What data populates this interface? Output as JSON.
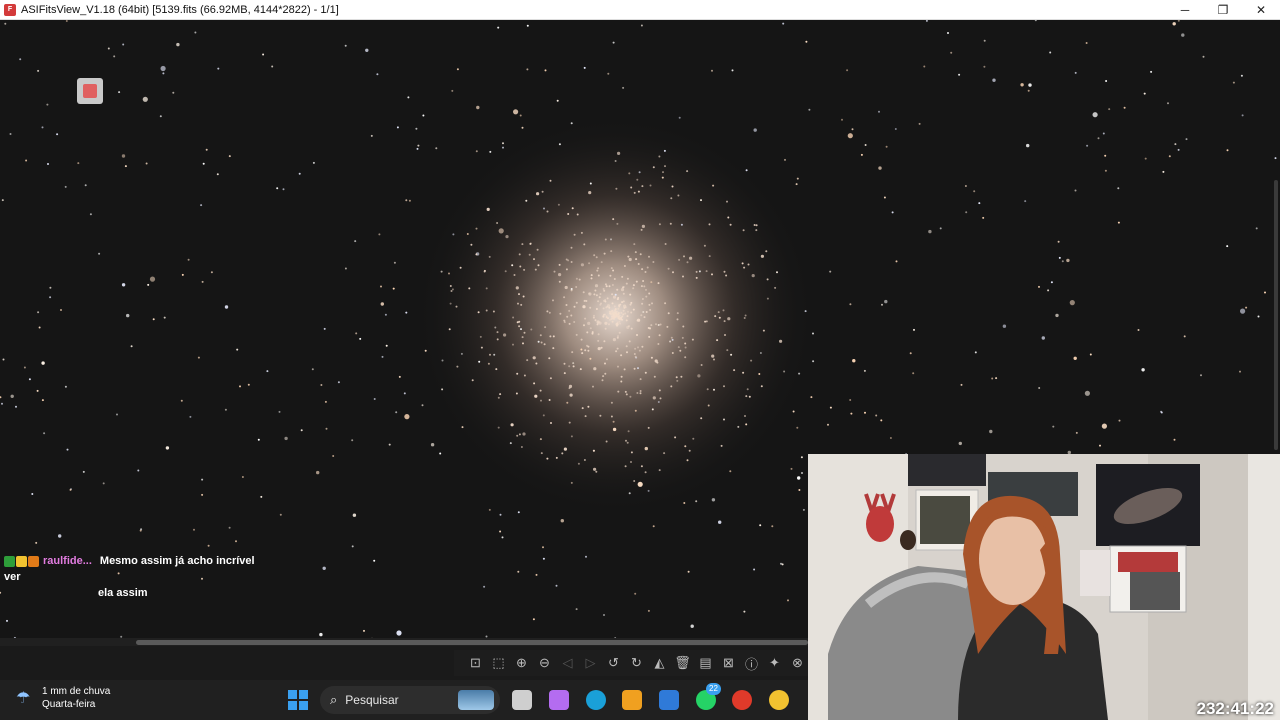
{
  "window": {
    "title": "ASIFitsView_V1.18 (64bit) [5139.fits (66.92MB, 4144*2822) - 1/1]",
    "app_icon": "asifitsview-icon",
    "controls": {
      "minimize": "─",
      "maximize": "❐",
      "close": "✕"
    }
  },
  "chat": {
    "username": "raulfide...",
    "message_line1": "Mesmo assim já acho incrível ver",
    "message_line2": "ela assim",
    "badge_colors": [
      "#2e9e3a",
      "#f2c230",
      "#e07a18"
    ]
  },
  "toolbar": {
    "tools": [
      {
        "name": "fit-icon",
        "glyph": "⊡",
        "enabled": true
      },
      {
        "name": "actual-size-icon",
        "glyph": "⬚",
        "enabled": true
      },
      {
        "name": "zoom-in-icon",
        "glyph": "⊕",
        "enabled": true
      },
      {
        "name": "zoom-out-icon",
        "glyph": "⊖",
        "enabled": true
      },
      {
        "name": "previous-icon",
        "glyph": "◁",
        "enabled": false
      },
      {
        "name": "next-icon",
        "glyph": "▷",
        "enabled": false
      },
      {
        "name": "rotate-left-icon",
        "glyph": "↺",
        "enabled": true
      },
      {
        "name": "rotate-right-icon",
        "glyph": "↻",
        "enabled": true
      },
      {
        "name": "histogram-icon",
        "glyph": "◭",
        "enabled": true
      },
      {
        "name": "delete-icon",
        "glyph": "🗑",
        "enabled": true
      },
      {
        "name": "save-icon",
        "glyph": "▤",
        "enabled": true
      },
      {
        "name": "crop-icon",
        "glyph": "⊠",
        "enabled": true
      },
      {
        "name": "info-icon",
        "glyph": "ⓘ",
        "enabled": true
      },
      {
        "name": "star-detect-icon",
        "glyph": "✦",
        "enabled": true
      },
      {
        "name": "crosshair-icon",
        "glyph": "⊗",
        "enabled": true
      }
    ]
  },
  "taskbar": {
    "weather_line1": "1 mm de chuva",
    "weather_line2": "Quarta-feira",
    "search_placeholder": "Pesquisar",
    "whatsapp_badge": "22",
    "apps": [
      {
        "name": "task-view-icon",
        "color": "#cfcfcf"
      },
      {
        "name": "copilot-icon",
        "color": "#b46cf0"
      },
      {
        "name": "edge-icon",
        "color": "#1aa0d8"
      },
      {
        "name": "store-icon",
        "color": "#f0a020"
      },
      {
        "name": "app-box-icon",
        "color": "#2f7ad8"
      },
      {
        "name": "whatsapp-icon",
        "color": "#25d366"
      },
      {
        "name": "opera-icon",
        "color": "#e03a2a"
      },
      {
        "name": "chrome-icon",
        "color": "#f2c230"
      }
    ]
  },
  "stream": {
    "uptime": "232:41:22"
  },
  "colors": {
    "sky": "#151515",
    "chat_username": "#e27ce0",
    "accent_blue": "#3aa0f0"
  }
}
